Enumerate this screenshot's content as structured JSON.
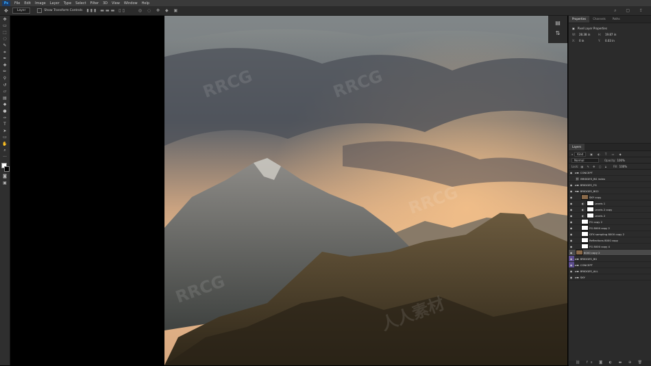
{
  "menubar": {
    "app_logo": "Ps",
    "items": [
      "File",
      "Edit",
      "Image",
      "Layer",
      "Type",
      "Select",
      "Filter",
      "3D",
      "View",
      "Window",
      "Help"
    ]
  },
  "options_bar": {
    "auto_select_target": "Layer",
    "show_transform_label": "Show Transform Controls"
  },
  "properties_panel": {
    "tabs": [
      "Properties",
      "Channels",
      "Paths"
    ],
    "section_title": "Pixel Layer Properties",
    "w_value": "28.38 in",
    "h_value": "19.87 in",
    "x_value": "0 in",
    "y_value": "0.03 in"
  },
  "layers_panel": {
    "tab": "Layers",
    "filter_kind": "Kind",
    "blend_mode": "Normal",
    "opacity_label": "Opacity:",
    "opacity_value": "100%",
    "lock_label": "Lock:",
    "fill_label": "Fill:",
    "fill_value": "100%",
    "rows": [
      {
        "name": "CONCEPT",
        "type": "group",
        "visible": true
      },
      {
        "name": "BRIDGES_BG index",
        "type": "layer",
        "visible": false
      },
      {
        "name": "BRIDGES_FG",
        "type": "group",
        "visible": true
      },
      {
        "name": "BRIDGES_BG2",
        "type": "group",
        "visible": true
      },
      {
        "name": "SKY copy",
        "type": "layer",
        "visible": true
      },
      {
        "name": "Levels 1",
        "type": "adjustment",
        "visible": true
      },
      {
        "name": "Levels 2 copy",
        "type": "adjustment",
        "visible": true
      },
      {
        "name": "Levels 2",
        "type": "adjustment",
        "visible": true
      },
      {
        "name": "FG copy 2",
        "type": "layer",
        "visible": true
      },
      {
        "name": "FG 8000 copy 2",
        "type": "layer",
        "visible": true
      },
      {
        "name": "GFX sampling 8000 copy 2",
        "type": "layer",
        "visible": true
      },
      {
        "name": "Reflections 8000 copy",
        "type": "layer",
        "visible": true
      },
      {
        "name": "FG 8000 copy 4",
        "type": "layer",
        "visible": true
      },
      {
        "name": "8000 copy 2",
        "type": "layer",
        "visible": true,
        "selected": true
      },
      {
        "name": "BRIDGES_BG",
        "type": "group",
        "visible": true,
        "color": "#5c4c8e"
      },
      {
        "name": "CONCEPT",
        "type": "group",
        "visible": true,
        "color": "#5c4c8e"
      },
      {
        "name": "BRIDGES_ALL",
        "type": "group",
        "visible": true
      },
      {
        "name": "SKY",
        "type": "group",
        "visible": true
      }
    ]
  },
  "watermarks": [
    "RRCG",
    "人人素材"
  ]
}
